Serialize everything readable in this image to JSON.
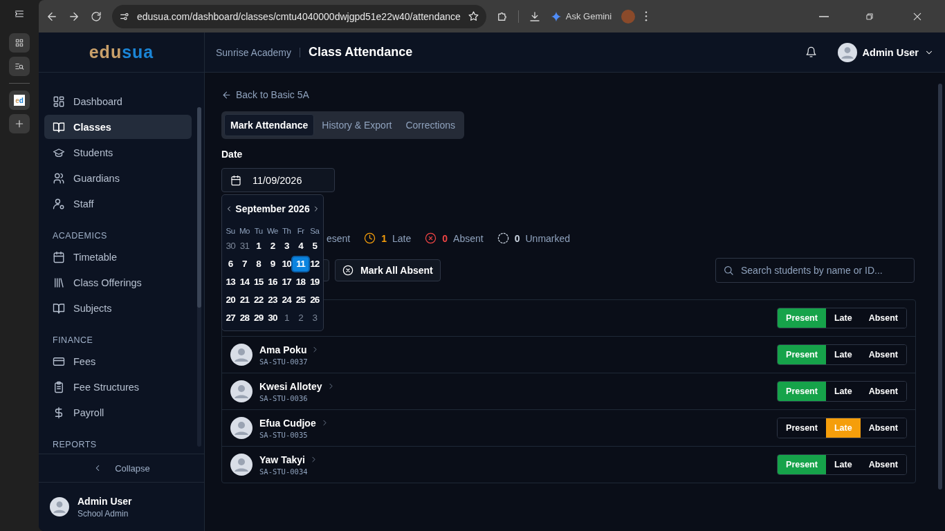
{
  "browser": {
    "url": "edusua.com/dashboard/classes/cmtu4040000dwjgpd51e22w40/attendance",
    "assistant": "Ask Gemini",
    "favicon_left": "e",
    "favicon_right": "d"
  },
  "sidebar": {
    "brand_left": "edu",
    "brand_right": "sua",
    "sections": [
      {
        "items": [
          {
            "label": "Dashboard",
            "selected": false
          },
          {
            "label": "Classes",
            "selected": true
          },
          {
            "label": "Students",
            "selected": false
          },
          {
            "label": "Guardians",
            "selected": false
          },
          {
            "label": "Staff",
            "selected": false
          }
        ]
      },
      {
        "heading": "ACADEMICS",
        "items": [
          {
            "label": "Timetable",
            "selected": false
          },
          {
            "label": "Class Offerings",
            "selected": false
          },
          {
            "label": "Subjects",
            "selected": false
          }
        ]
      },
      {
        "heading": "FINANCE",
        "items": [
          {
            "label": "Fees",
            "selected": false
          },
          {
            "label": "Fee Structures",
            "selected": false
          },
          {
            "label": "Payroll",
            "selected": false
          }
        ]
      },
      {
        "heading": "REPORTS"
      }
    ],
    "collapse": "Collapse",
    "user": {
      "name": "Admin User",
      "role": "School Admin"
    }
  },
  "header": {
    "school": "Sunrise Academy",
    "title": "Class Attendance",
    "user": "Admin User"
  },
  "back_link": "Back to Basic 5A",
  "tabs": [
    {
      "label": "Mark Attendance",
      "selected": true
    },
    {
      "label": "History & Export",
      "selected": false
    },
    {
      "label": "Corrections",
      "selected": false
    }
  ],
  "date": {
    "label": "Date",
    "value": "11/09/2026"
  },
  "calendar": {
    "month": "September 2026",
    "weekdays": [
      "Su",
      "Mo",
      "Tu",
      "We",
      "Th",
      "Fr",
      "Sa"
    ],
    "weeks": [
      [
        {
          "day": "30",
          "outside": true,
          "selected": false
        },
        {
          "day": "31",
          "outside": true,
          "selected": false
        },
        {
          "day": "1",
          "outside": false,
          "selected": false
        },
        {
          "day": "2",
          "outside": false,
          "selected": false
        },
        {
          "day": "3",
          "outside": false,
          "selected": false
        },
        {
          "day": "4",
          "outside": false,
          "selected": false
        },
        {
          "day": "5",
          "outside": false,
          "selected": false
        }
      ],
      [
        {
          "day": "6",
          "outside": false,
          "selected": false
        },
        {
          "day": "7",
          "outside": false,
          "selected": false
        },
        {
          "day": "8",
          "outside": false,
          "selected": false
        },
        {
          "day": "9",
          "outside": false,
          "selected": false
        },
        {
          "day": "10",
          "outside": false,
          "selected": false
        },
        {
          "day": "11",
          "outside": false,
          "selected": true
        },
        {
          "day": "12",
          "outside": false,
          "selected": false
        }
      ],
      [
        {
          "day": "13",
          "outside": false,
          "selected": false
        },
        {
          "day": "14",
          "outside": false,
          "selected": false
        },
        {
          "day": "15",
          "outside": false,
          "selected": false
        },
        {
          "day": "16",
          "outside": false,
          "selected": false
        },
        {
          "day": "17",
          "outside": false,
          "selected": false
        },
        {
          "day": "18",
          "outside": false,
          "selected": false
        },
        {
          "day": "19",
          "outside": false,
          "selected": false
        }
      ],
      [
        {
          "day": "20",
          "outside": false,
          "selected": false
        },
        {
          "day": "21",
          "outside": false,
          "selected": false
        },
        {
          "day": "22",
          "outside": false,
          "selected": false
        },
        {
          "day": "23",
          "outside": false,
          "selected": false
        },
        {
          "day": "24",
          "outside": false,
          "selected": false
        },
        {
          "day": "25",
          "outside": false,
          "selected": false
        },
        {
          "day": "26",
          "outside": false,
          "selected": false
        }
      ],
      [
        {
          "day": "27",
          "outside": false,
          "selected": false
        },
        {
          "day": "28",
          "outside": false,
          "selected": false
        },
        {
          "day": "29",
          "outside": false,
          "selected": false
        },
        {
          "day": "30",
          "outside": false,
          "selected": false
        },
        {
          "day": "1",
          "outside": true,
          "selected": false
        },
        {
          "day": "2",
          "outside": true,
          "selected": false
        },
        {
          "day": "3",
          "outside": true,
          "selected": false
        }
      ]
    ]
  },
  "summary": [
    {
      "kind": "present",
      "label": "esent"
    },
    {
      "kind": "late",
      "count": "1",
      "label": "Late"
    },
    {
      "kind": "absent",
      "count": "0",
      "label": "Absent"
    },
    {
      "kind": "unmarked",
      "count": "0",
      "label": "Unmarked"
    }
  ],
  "mark_all_absent": "Mark All Absent",
  "search": {
    "placeholder": "Search students by name or ID..."
  },
  "students": [
    {
      "options": [
        {
          "kind": "present",
          "label": "Present",
          "selected": true
        },
        {
          "kind": "late",
          "label": "Late",
          "selected": false
        },
        {
          "kind": "absent",
          "label": "Absent",
          "selected": false
        }
      ]
    },
    {
      "name": "Ama Poku",
      "id": "SA-STU-0037",
      "options": [
        {
          "kind": "present",
          "label": "Present",
          "selected": true
        },
        {
          "kind": "late",
          "label": "Late",
          "selected": false
        },
        {
          "kind": "absent",
          "label": "Absent",
          "selected": false
        }
      ]
    },
    {
      "name": "Kwesi Allotey",
      "id": "SA-STU-0036",
      "options": [
        {
          "kind": "present",
          "label": "Present",
          "selected": true
        },
        {
          "kind": "late",
          "label": "Late",
          "selected": false
        },
        {
          "kind": "absent",
          "label": "Absent",
          "selected": false
        }
      ]
    },
    {
      "name": "Efua Cudjoe",
      "id": "SA-STU-0035",
      "options": [
        {
          "kind": "present",
          "label": "Present",
          "selected": false
        },
        {
          "kind": "late",
          "label": "Late",
          "selected": true
        },
        {
          "kind": "absent",
          "label": "Absent",
          "selected": false
        }
      ]
    },
    {
      "name": "Yaw Takyi",
      "id": "SA-STU-0034",
      "options": [
        {
          "kind": "present",
          "label": "Present",
          "selected": true
        },
        {
          "kind": "late",
          "label": "Late",
          "selected": false
        },
        {
          "kind": "absent",
          "label": "Absent",
          "selected": false
        }
      ]
    }
  ]
}
